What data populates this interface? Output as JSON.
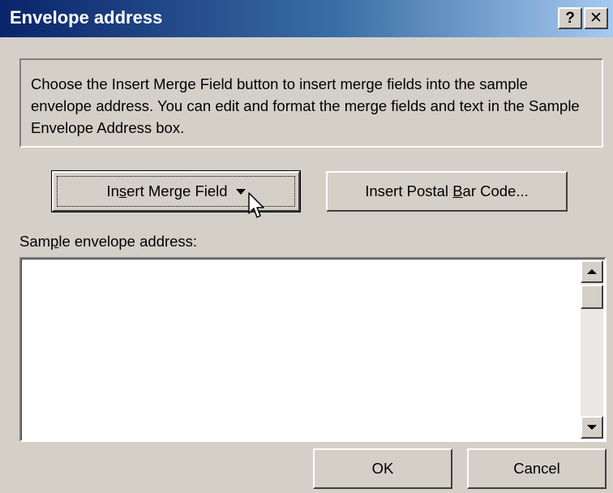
{
  "window": {
    "title": "Envelope address",
    "help_glyph": "?",
    "close_glyph": "✕"
  },
  "info": {
    "text": "Choose the Insert Merge Field button to insert merge fields into the sample envelope address.  You can edit and format the merge fields and text in the Sample Envelope Address box."
  },
  "buttons": {
    "insert_merge_field": {
      "pre": "In",
      "accel": "s",
      "post": "ert Merge Field"
    },
    "insert_postal": {
      "pre": "Insert Postal ",
      "accel": "B",
      "post": "ar Code..."
    },
    "ok": "OK",
    "cancel": "Cancel"
  },
  "sample": {
    "label_pre": "Sam",
    "label_accel": "p",
    "label_post": "le envelope address:",
    "value": ""
  },
  "colors": {
    "dialog_bg": "#d4d0c8",
    "title_start": "#0a246a",
    "title_end": "#a6caf0"
  }
}
